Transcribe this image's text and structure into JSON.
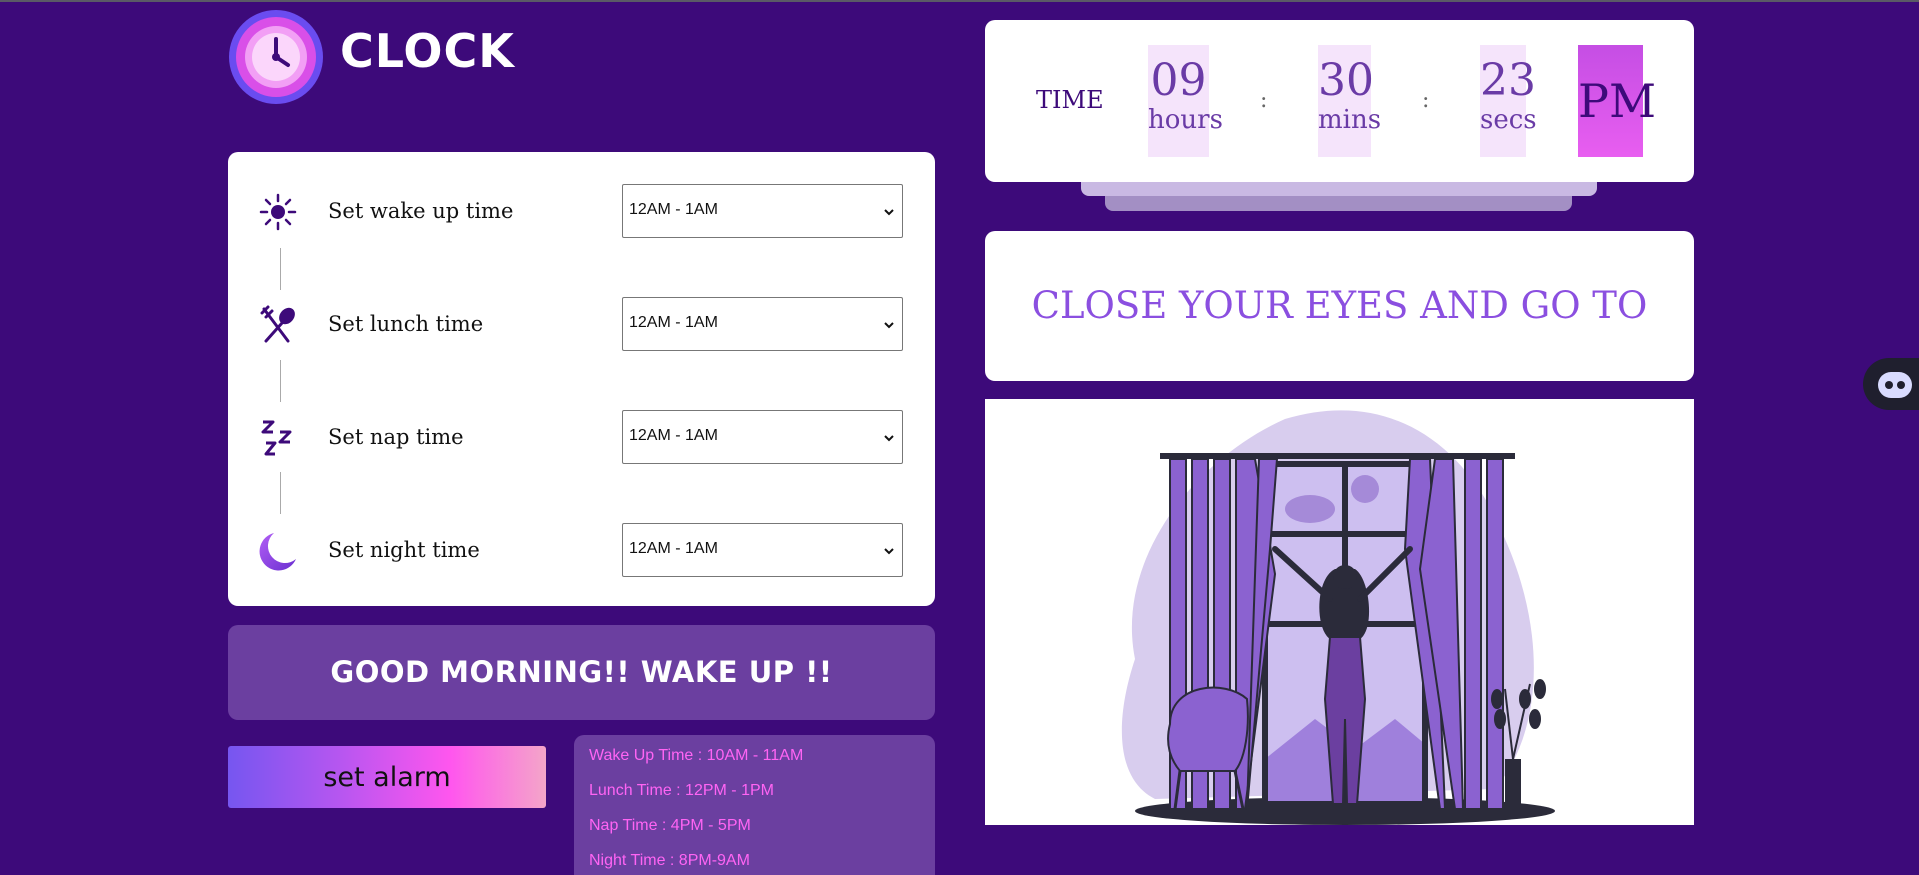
{
  "app": {
    "title": "CLOCK"
  },
  "settings": {
    "rows": [
      {
        "label": "Set wake up time",
        "value": "12AM - 1AM",
        "icon": "sun-icon"
      },
      {
        "label": "Set lunch time",
        "value": "12AM - 1AM",
        "icon": "fork-spoon-icon"
      },
      {
        "label": "Set nap time",
        "value": "12AM - 1AM",
        "icon": "zzz-icon"
      },
      {
        "label": "Set night time",
        "value": "12AM - 1AM",
        "icon": "moon-icon"
      }
    ]
  },
  "greeting": "GOOD MORNING!! WAKE UP !!",
  "alarm_button": "set alarm",
  "schedule": {
    "wake": "Wake Up Time : 10AM - 11AM",
    "lunch": "Lunch Time : 12PM - 1PM",
    "nap": "Nap Time : 4PM - 5PM",
    "night": "Night Time : 8PM-9AM"
  },
  "time": {
    "label": "TIME",
    "hours": "09",
    "hours_unit": "hours",
    "mins": "30",
    "mins_unit": "mins",
    "secs": "23",
    "secs_unit": "secs",
    "sep": ":",
    "ampm": "PM"
  },
  "message": "CLOSE YOUR EYES AND GO TO SLEEP",
  "colors": {
    "background": "#3d0a7a",
    "card": "#ffffff",
    "panel": "#6b3fa0",
    "accent": "#8b4fe0",
    "pink": "#ff64f4"
  }
}
